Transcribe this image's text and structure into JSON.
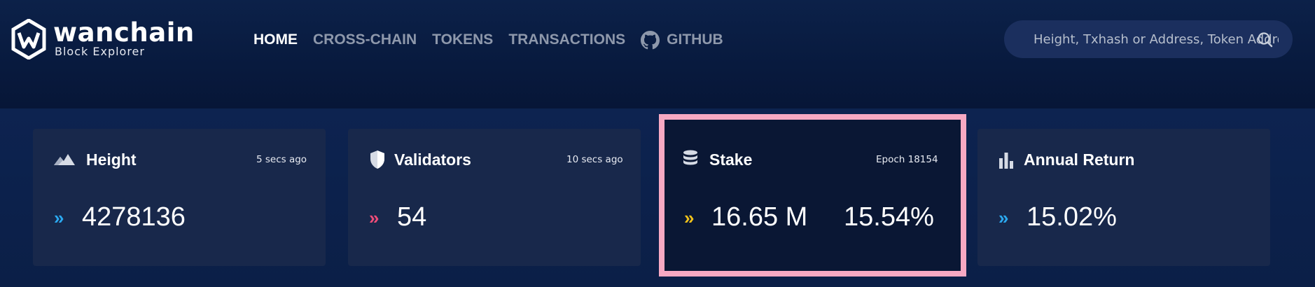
{
  "brand": {
    "name": "wanchain",
    "subtitle": "Block Explorer"
  },
  "nav": {
    "items": [
      {
        "label": "HOME",
        "active": true
      },
      {
        "label": "CROSS-CHAIN",
        "active": false
      },
      {
        "label": "TOKENS",
        "active": false
      },
      {
        "label": "TRANSACTIONS",
        "active": false
      },
      {
        "label": "GITHUB",
        "active": false,
        "icon": "github-icon"
      }
    ]
  },
  "search": {
    "placeholder": "Height, Txhash or Address, Token Address",
    "icon": "search-icon"
  },
  "cards": {
    "height": {
      "title": "Height",
      "meta": "5 secs ago",
      "value": "4278136",
      "icon": "mountain-icon",
      "chevron": "»",
      "chevron_color": "#2ba9f0"
    },
    "validators": {
      "title": "Validators",
      "meta": "10 secs ago",
      "value": "54",
      "icon": "shield-icon",
      "chevron": "»",
      "chevron_color": "#f04d79"
    },
    "stake": {
      "title": "Stake",
      "meta": "Epoch 18154",
      "value": "16.65 M",
      "percent": "15.54%",
      "icon": "database-icon",
      "chevron": "»",
      "chevron_color": "#f2c21b",
      "highlighted": true
    },
    "annual_return": {
      "title": "Annual Return",
      "value": "15.02%",
      "icon": "bar-chart-icon",
      "chevron": "»",
      "chevron_color": "#2ba9f0"
    }
  },
  "colors": {
    "header_bg": "#0c2149",
    "card_bg": "#18284b",
    "highlight_border": "#f7a9c3",
    "nav_inactive": "#8e98ab",
    "nav_active": "#ffffff"
  }
}
